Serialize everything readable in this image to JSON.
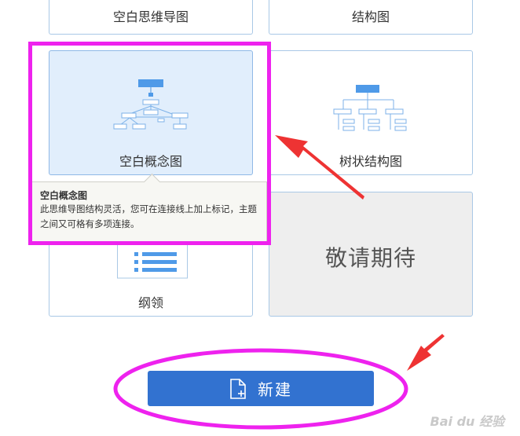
{
  "templates": {
    "top_left_label": "空白思维导图",
    "top_right_label": "结构图",
    "concept_label": "空白概念图",
    "tree_label": "树状结构图",
    "outline_label": "纲领",
    "coming_soon_label": "敬请期待"
  },
  "tooltip": {
    "title": "空白概念图",
    "description": "此思维导图结构灵活，您可在连接线上加上标记，主题之间又可格有多项连接。"
  },
  "actions": {
    "new_label": "新建"
  },
  "watermark": "Bai du 经验",
  "colors": {
    "accent": "#3272d0",
    "highlight": "#ee22ee",
    "arrow": "#ee3333",
    "selected_card": "#e1eefc"
  }
}
